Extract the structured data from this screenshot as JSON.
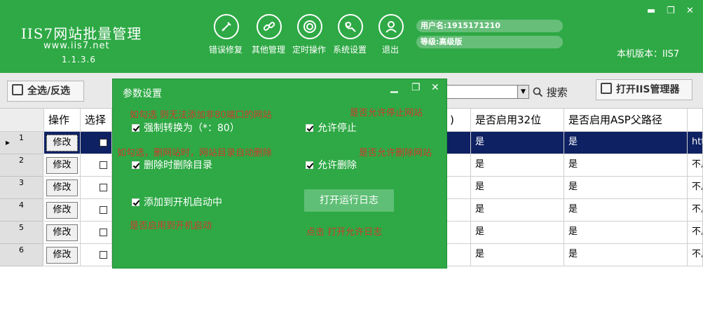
{
  "header": {
    "logo_title": "IIS7网站批量管理",
    "logo_url": "www.iis7.net",
    "logo_version": "1.1.3.6",
    "tools": [
      {
        "label": "错误修复",
        "icon": "repair-icon"
      },
      {
        "label": "其他管理",
        "icon": "link-icon"
      },
      {
        "label": "定时操作",
        "icon": "timer-icon"
      },
      {
        "label": "系统设置",
        "icon": "settings-icon"
      },
      {
        "label": "退出",
        "icon": "user-icon"
      }
    ],
    "username": "用户名:1915171210",
    "level": "等级:高级版",
    "local_version": "本机版本：IIS7",
    "window_controls": {
      "minimize": "▬",
      "restore": "❐",
      "close": "✕"
    }
  },
  "toolbar": {
    "select_all_label": "全选/反选",
    "combo_value": "",
    "search_label": "搜索",
    "open_iis_label": "打开IIS管理器"
  },
  "grid": {
    "columns": [
      "操作",
      "选择",
      ")",
      "是否启用32位",
      "是否启用ASP父路径",
      ""
    ],
    "edit_label": "修改",
    "rows": [
      {
        "num": "1",
        "col32": "是",
        "asp": "是",
        "tail": "htt"
      },
      {
        "num": "2",
        "col32": "是",
        "asp": "是",
        "tail": "不用"
      },
      {
        "num": "3",
        "col32": "是",
        "asp": "是",
        "tail": "不用"
      },
      {
        "num": "4",
        "col32": "是",
        "asp": "是",
        "tail": "不用"
      },
      {
        "num": "5",
        "col32": "是",
        "asp": "是",
        "tail": "不用"
      },
      {
        "num": "6",
        "col32": "是",
        "asp": "是",
        "tail": "不用"
      }
    ]
  },
  "dialog": {
    "title": "参数设置",
    "options": {
      "force_convert": "强制转换为（*：80）",
      "allow_stop": "允许停止",
      "delete_dir": "删除时删除目录",
      "allow_delete": "允许删除",
      "add_startup": "添加到开机启动中"
    },
    "open_log_label": "打开运行日志",
    "notes": {
      "n1": "如勾选 则无法添加非80端口的网站",
      "n2": "是否允许停止网站",
      "n3": "如勾选，删网站时，网站目录自动删除",
      "n4": "是否允许删除网站",
      "n5": "是否启用到开机启动",
      "n6": "点击 打开允许日志"
    }
  }
}
